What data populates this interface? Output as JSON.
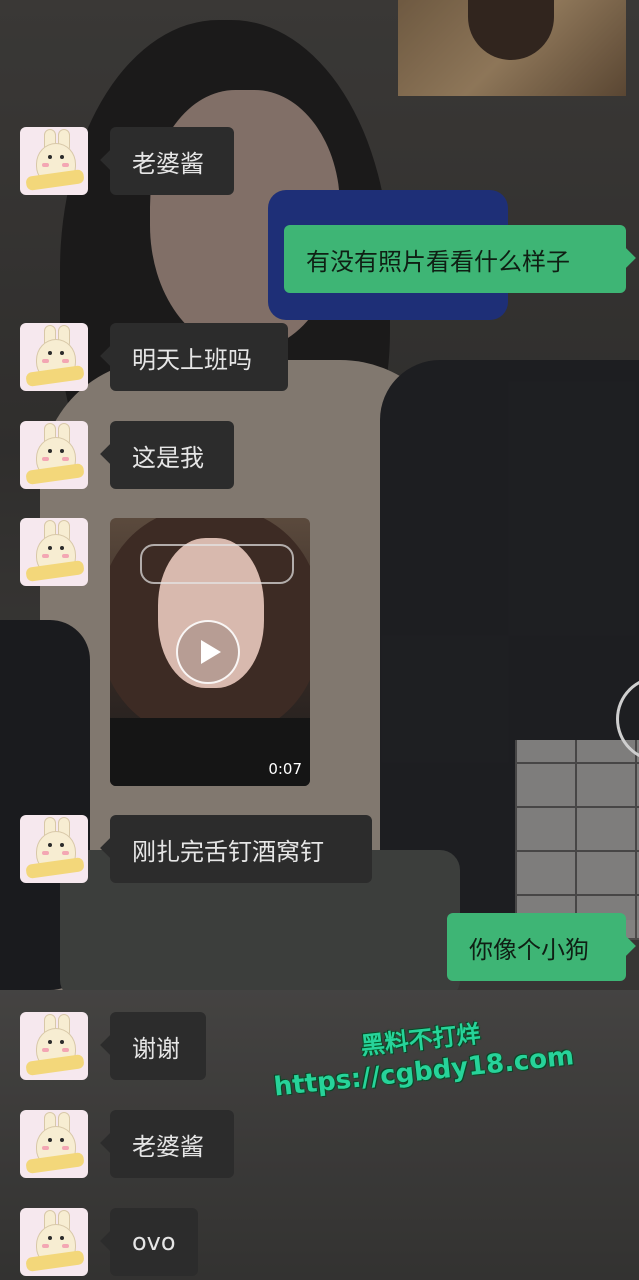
{
  "chat": {
    "messages": [
      {
        "side": "in",
        "text": "老婆酱"
      },
      {
        "side": "out",
        "text": "有没有照片看看什么样子"
      },
      {
        "side": "in",
        "text": "明天上班吗"
      },
      {
        "side": "in",
        "text": "这是我"
      },
      {
        "side": "in",
        "type": "video",
        "duration": "0:07"
      },
      {
        "side": "in",
        "text": "刚扎完舌钉酒窝钉"
      },
      {
        "side": "out",
        "text": "你像个小狗"
      },
      {
        "side": "in",
        "text": "谢谢"
      },
      {
        "side": "in",
        "text": "老婆酱"
      },
      {
        "side": "in",
        "text": "ovo"
      }
    ]
  },
  "watermark": {
    "line1": "黑料不打烊",
    "line2": "https://cgbdy18.com"
  },
  "colors": {
    "incoming_bubble": "#2c2c2c",
    "outgoing_bubble": "#3eb575",
    "watermark": "#27d39a"
  },
  "icons": {
    "avatar": "rabbit-avatar-icon",
    "play": "play-icon"
  }
}
